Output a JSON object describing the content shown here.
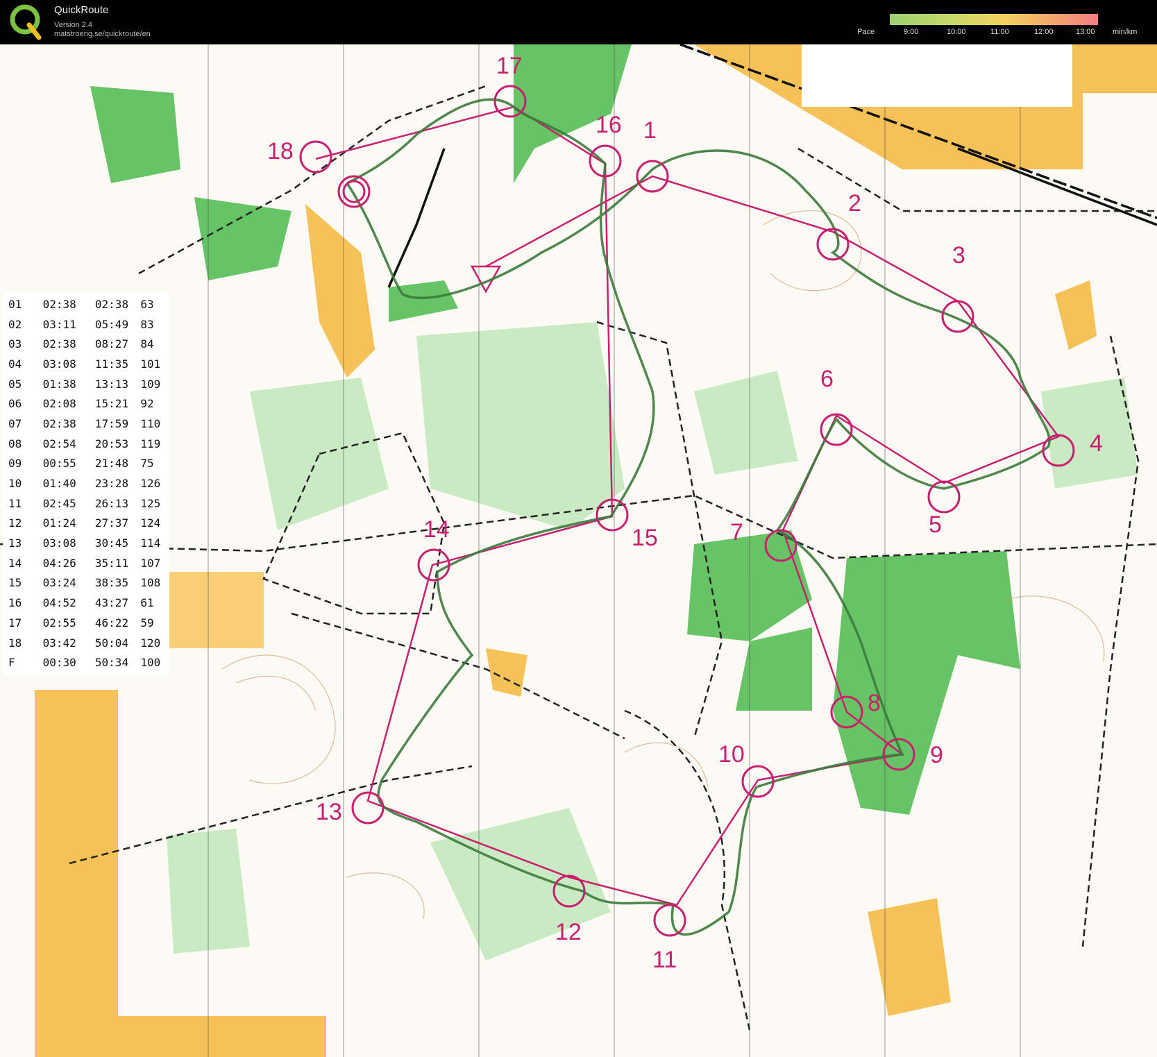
{
  "app": {
    "name": "QuickRoute",
    "version": "Version 2.4",
    "url": "matstroeng.se/quickroute/en"
  },
  "pace_legend": {
    "label": "Pace",
    "ticks": [
      "9:00",
      "10:00",
      "11:00",
      "12:00",
      "13:00"
    ],
    "unit": "min/km"
  },
  "controls": [
    {
      "label": "1"
    },
    {
      "label": "2"
    },
    {
      "label": "3"
    },
    {
      "label": "4"
    },
    {
      "label": "5"
    },
    {
      "label": "6"
    },
    {
      "label": "7"
    },
    {
      "label": "8"
    },
    {
      "label": "9"
    },
    {
      "label": "10"
    },
    {
      "label": "11"
    },
    {
      "label": "12"
    },
    {
      "label": "13"
    },
    {
      "label": "14"
    },
    {
      "label": "15"
    },
    {
      "label": "16"
    },
    {
      "label": "17"
    },
    {
      "label": "18"
    }
  ],
  "splits": [
    {
      "leg": "01",
      "time": "02:38",
      "total": "02:38",
      "code": "63"
    },
    {
      "leg": "02",
      "time": "03:11",
      "total": "05:49",
      "code": "83"
    },
    {
      "leg": "03",
      "time": "02:38",
      "total": "08:27",
      "code": "84"
    },
    {
      "leg": "04",
      "time": "03:08",
      "total": "11:35",
      "code": "101"
    },
    {
      "leg": "05",
      "time": "01:38",
      "total": "13:13",
      "code": "109"
    },
    {
      "leg": "06",
      "time": "02:08",
      "total": "15:21",
      "code": "92"
    },
    {
      "leg": "07",
      "time": "02:38",
      "total": "17:59",
      "code": "110"
    },
    {
      "leg": "08",
      "time": "02:54",
      "total": "20:53",
      "code": "119"
    },
    {
      "leg": "09",
      "time": "00:55",
      "total": "21:48",
      "code": "75"
    },
    {
      "leg": "10",
      "time": "01:40",
      "total": "23:28",
      "code": "126"
    },
    {
      "leg": "11",
      "time": "02:45",
      "total": "26:13",
      "code": "125"
    },
    {
      "leg": "12",
      "time": "01:24",
      "total": "27:37",
      "code": "124"
    },
    {
      "leg": "13",
      "time": "03:08",
      "total": "30:45",
      "code": "114"
    },
    {
      "leg": "14",
      "time": "04:26",
      "total": "35:11",
      "code": "107"
    },
    {
      "leg": "15",
      "time": "03:24",
      "total": "38:35",
      "code": "108"
    },
    {
      "leg": "16",
      "time": "04:52",
      "total": "43:27",
      "code": "61"
    },
    {
      "leg": "17",
      "time": "02:55",
      "total": "46:22",
      "code": "59"
    },
    {
      "leg": "18",
      "time": "03:42",
      "total": "50:04",
      "code": "120"
    },
    {
      "leg": "F",
      "time": "00:30",
      "total": "50:34",
      "code": "100"
    }
  ],
  "colors": {
    "course": "#c8206e",
    "route": "#3c7a3c",
    "forest": "#4cba4c",
    "open": "#f5b83a"
  }
}
